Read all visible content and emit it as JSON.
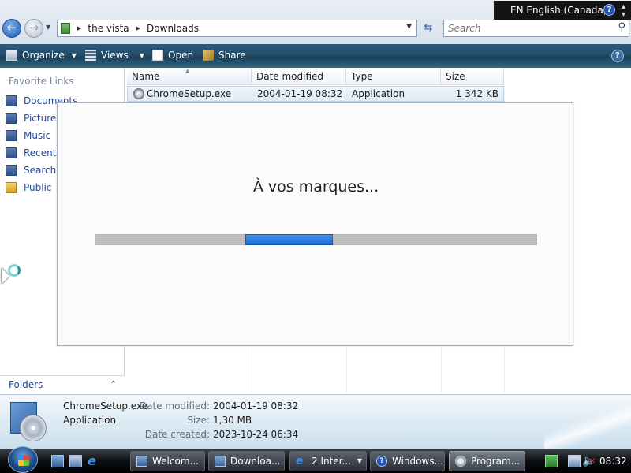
{
  "address": {
    "back_icon": "back-arrow-icon",
    "forward_icon": "forward-arrow-icon",
    "breadcrumb": [
      "the vista",
      "Downloads"
    ],
    "search_placeholder": "Search"
  },
  "language_bar": {
    "label": "EN English (Canada)",
    "help": "?"
  },
  "command_bar": {
    "organize": "Organize",
    "views": "Views",
    "open": "Open",
    "share": "Share",
    "help": "?"
  },
  "nav_pane": {
    "heading": "Favorite Links",
    "items": [
      {
        "label": "Documents",
        "icon": "documents-icon"
      },
      {
        "label": "Pictures",
        "icon": "pictures-icon"
      },
      {
        "label": "Music",
        "icon": "music-icon"
      },
      {
        "label": "Recently Changed",
        "icon": "recently-changed-icon"
      },
      {
        "label": "Searches",
        "icon": "searches-icon"
      },
      {
        "label": "Public",
        "icon": "public-folder-icon"
      }
    ],
    "folders_label": "Folders"
  },
  "file_list": {
    "columns": [
      "Name",
      "Date modified",
      "Type",
      "Size"
    ],
    "sorted_column": "Name",
    "rows": [
      {
        "name": "ChromeSetup.exe",
        "date_modified": "2004-01-19 08:32",
        "type": "Application",
        "size": "1 342 KB"
      }
    ]
  },
  "dialog": {
    "message": "À vos marques...",
    "progress_state": "indeterminate",
    "accent_color": "#1c6ad6"
  },
  "details_pane": {
    "name": "ChromeSetup.exe",
    "type": "Application",
    "date_modified_label": "Date modified:",
    "date_modified": "2004-01-19 08:32",
    "size_label": "Size:",
    "size": "1,30 MB",
    "date_created_label": "Date created:",
    "date_created": "2023-10-24 06:34"
  },
  "taskbar": {
    "tasks": [
      {
        "label": "Welcom...",
        "icon": "window-icon",
        "active": false
      },
      {
        "label": "Downloa...",
        "icon": "folder-icon",
        "active": false
      },
      {
        "label": "2 Inter...",
        "icon": "ie-icon",
        "active": false
      },
      {
        "label": "Windows...",
        "icon": "help-icon",
        "active": false
      },
      {
        "label": "Program...",
        "icon": "setup-icon",
        "active": true
      }
    ],
    "clock": "08:32"
  }
}
